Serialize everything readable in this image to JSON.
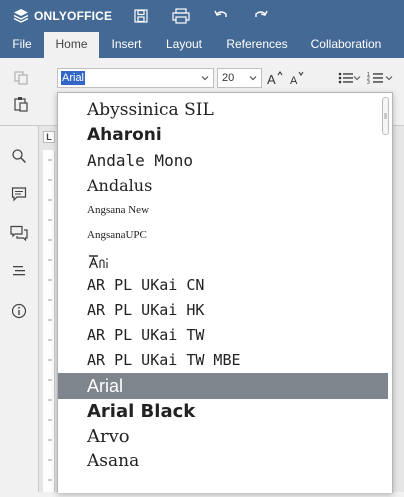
{
  "app": {
    "brand": "ONLYOFFICE"
  },
  "tabs": [
    {
      "label": "File"
    },
    {
      "label": "Home"
    },
    {
      "label": "Insert"
    },
    {
      "label": "Layout"
    },
    {
      "label": "References"
    },
    {
      "label": "Collaboration"
    }
  ],
  "toolbar": {
    "font_name": "Arial",
    "font_size": "20"
  },
  "ruler": {
    "corner_label": "L"
  },
  "font_list": [
    {
      "label": "Abyssinica SIL"
    },
    {
      "label": "Aharoni"
    },
    {
      "label": "Andale Mono"
    },
    {
      "label": "Andalus"
    },
    {
      "label": "Angsana New"
    },
    {
      "label": "AngsanaUPC"
    },
    {
      "label": "Ani"
    },
    {
      "label": "AR PL UKai CN"
    },
    {
      "label": "AR PL UKai HK"
    },
    {
      "label": "AR PL UKai TW"
    },
    {
      "label": "AR PL UKai TW MBE"
    },
    {
      "label": "Arial"
    },
    {
      "label": "Arial Black"
    },
    {
      "label": "Arvo"
    },
    {
      "label": "Asana"
    }
  ],
  "colors": {
    "header_bg": "#446995",
    "toolbar_bg": "#f1f1f1",
    "selected_item_bg": "#7e858d",
    "font_value_highlight": "#3367c7"
  }
}
